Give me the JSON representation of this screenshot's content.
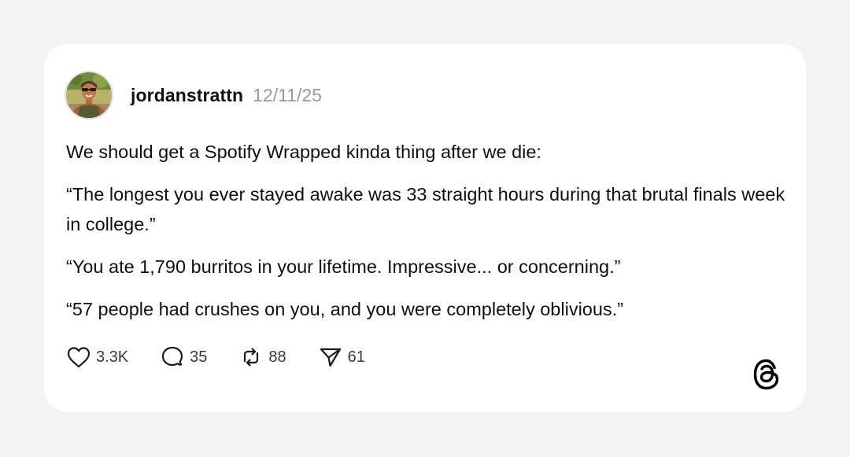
{
  "post": {
    "username": "jordanstrattn",
    "date": "12/11/25",
    "paragraphs": [
      "We should get a Spotify Wrapped kinda thing after we die:",
      "“The longest you ever stayed awake was 33 straight hours during that brutal finals week in college.”",
      "“You ate 1,790 burritos in your lifetime. Impressive... or concerning.”",
      "“57 people had crushes on you, and you were completely oblivious.”"
    ],
    "actions": {
      "likes": "3.3K",
      "replies": "35",
      "reposts": "88",
      "shares": "61"
    }
  },
  "icons": {
    "like": "heart-icon",
    "reply": "speech-bubble-icon",
    "repost": "repost-icon",
    "share": "send-icon",
    "brand": "threads-logo-icon"
  },
  "colors": {
    "page_background": "#f3f3f3",
    "card_background": "#ffffff",
    "text": "#101010",
    "date": "#9a9a9a"
  }
}
